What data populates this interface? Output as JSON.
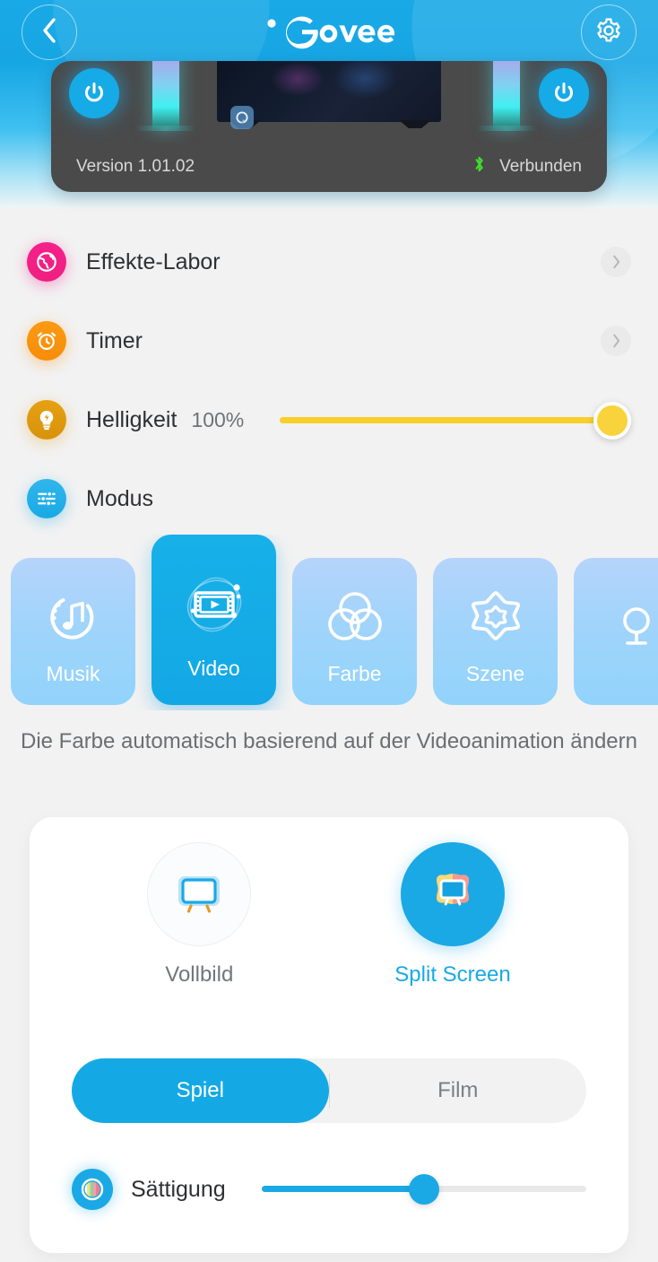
{
  "header": {
    "back_icon": "chevron-left-icon",
    "brand": "Govee",
    "settings_icon": "gear-icon"
  },
  "device": {
    "version": "Version 1.01.02",
    "bluetooth_icon": "bluetooth-icon",
    "connection_status": "Verbunden",
    "power_left_icon": "power-icon",
    "power_right_icon": "power-icon",
    "colors": {
      "bluetooth": "#3ee02c",
      "card_bg": "#4a4a4a"
    }
  },
  "rows": [
    {
      "id": "effects-lab",
      "icon": "globe-icon",
      "label": "Effekte-Labor",
      "accent": "#f6218b",
      "chevron": "chevron-right-icon"
    },
    {
      "id": "timer",
      "icon": "alarm-clock-icon",
      "label": "Timer",
      "accent": "#fb9a12",
      "chevron": "chevron-right-icon"
    },
    {
      "id": "brightness",
      "icon": "bulb-icon",
      "label": "Helligkeit",
      "value": "100%",
      "accent": "#e6a012",
      "slider_percent": 100
    },
    {
      "id": "mode",
      "icon": "sliders-icon",
      "label": "Modus",
      "accent": "#1aa9e5"
    }
  ],
  "modes": {
    "items": [
      {
        "id": "music",
        "label": "Musik",
        "icon": "music-note-icon",
        "selected": false
      },
      {
        "id": "video",
        "label": "Video",
        "icon": "film-play-icon",
        "selected": true
      },
      {
        "id": "color",
        "label": "Farbe",
        "icon": "color-circles-icon",
        "selected": false
      },
      {
        "id": "scene",
        "label": "Szene",
        "icon": "star-icon",
        "selected": false
      },
      {
        "id": "mic",
        "label": "",
        "icon": "mic-icon",
        "selected": false
      }
    ],
    "description": "Die Farbe automatisch basierend auf der Videoanimation ändern"
  },
  "panel": {
    "screen_modes": [
      {
        "id": "fullscreen",
        "label": "Vollbild",
        "icon": "tv-icon",
        "selected": false
      },
      {
        "id": "split-screen",
        "label": "Split Screen",
        "icon": "tv-color-icon",
        "selected": true
      }
    ],
    "segments": [
      {
        "id": "game",
        "label": "Spiel",
        "selected": true
      },
      {
        "id": "movie",
        "label": "Film",
        "selected": false
      }
    ],
    "saturation": {
      "icon": "saturation-icon",
      "label": "Sättigung",
      "percent": 50
    }
  },
  "colors": {
    "accent": "#1aa9e5",
    "brightness": "#f8cf2b",
    "background": "#f2f2f2",
    "header_blue": "#19a9e6"
  }
}
